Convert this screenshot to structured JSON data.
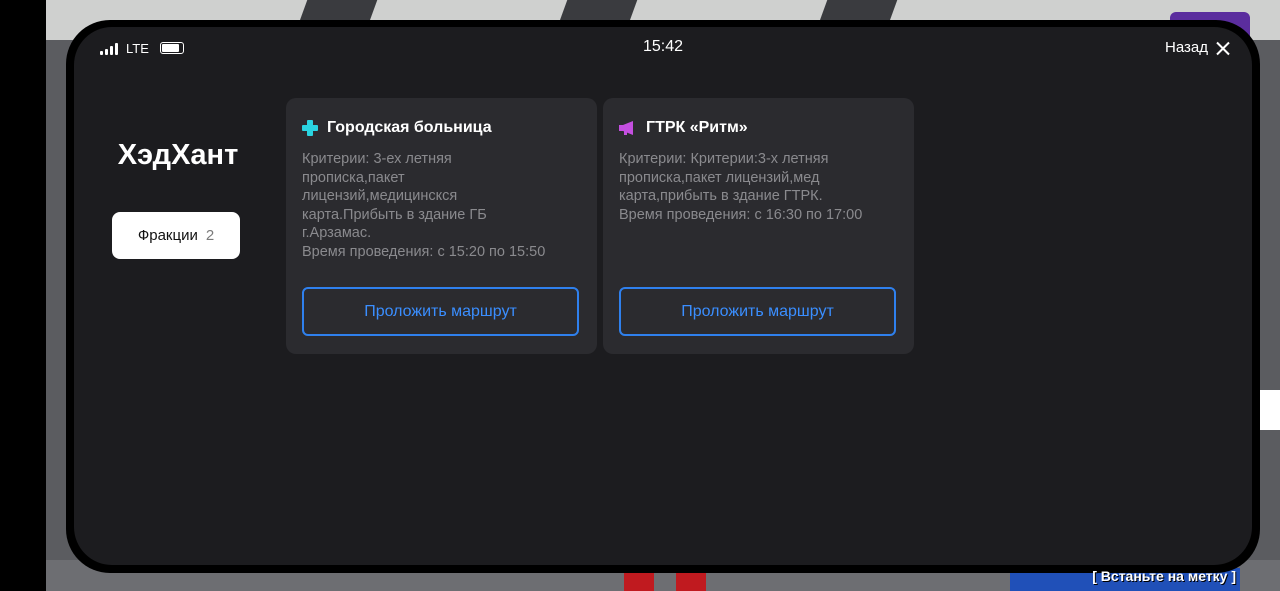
{
  "status_bar": {
    "network": "LTE",
    "time": "15:42",
    "back_label": "Назад"
  },
  "page": {
    "title": "ХэдХант",
    "filter": {
      "label": "Фракции",
      "count": "2"
    }
  },
  "cards": [
    {
      "icon": "hospital-cross-icon",
      "icon_color": "#2ad4e0",
      "title": "Городская больница",
      "body": "Критерии: 3-ех летняя\nпрописка,пакет\nлицензий,медицинскся\nкарта.Прибыть в здание ГБ\nг.Арзамас.\nВремя проведения: с 15:20 по 15:50",
      "button": "Проложить маршрут"
    },
    {
      "icon": "megaphone-icon",
      "icon_color": "#c44fe0",
      "title": "ГТРК «Ритм»",
      "body": "Критерии: Критерии:3-х летняя\nпрописка,пакет лицензий,мед\nкарта,прибыть в здание ГТРК.\nВремя проведения: с 16:30 по 17:00",
      "button": "Проложить маршрут"
    }
  ],
  "game_hint": "[ Встаньте на метку ]",
  "colors": {
    "accent": "#2f80ed",
    "background": "#1c1c1f",
    "card": "#2b2b2f"
  }
}
